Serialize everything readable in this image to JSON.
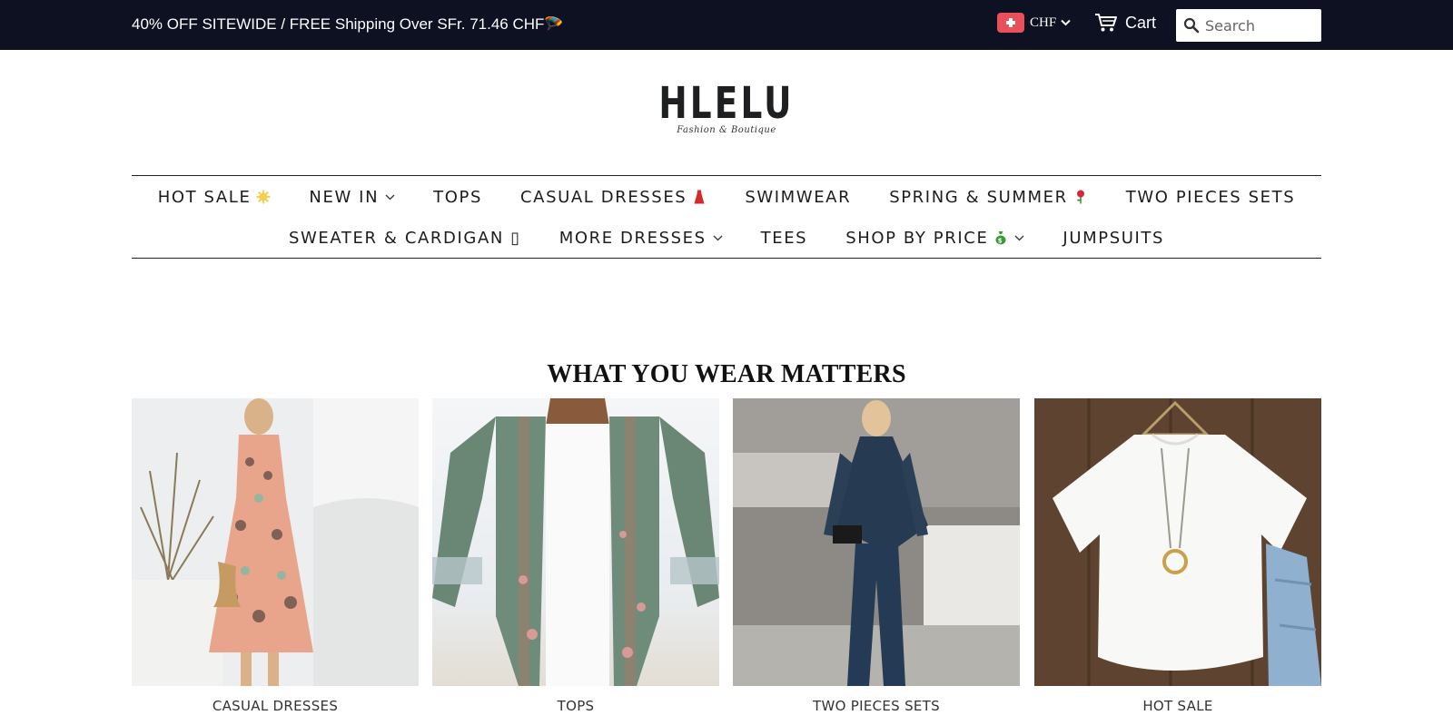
{
  "announcement": "40% OFF SITEWIDE / FREE Shipping Over SFr. 71.46 CHF🪂",
  "currency": {
    "code": "CHF",
    "flag_color": "#e8505b"
  },
  "cart": {
    "label": "Cart"
  },
  "search": {
    "placeholder": "Search"
  },
  "logo": {
    "name": "HLELU",
    "tagline": "Fashion & Boutique"
  },
  "nav": {
    "row1": [
      {
        "label": "HOT SALE",
        "emoji": "sun",
        "dropdown": false
      },
      {
        "label": "NEW IN",
        "dropdown": true
      },
      {
        "label": "TOPS",
        "dropdown": false
      },
      {
        "label": "CASUAL DRESSES",
        "emoji": "dress",
        "dropdown": false
      },
      {
        "label": "SWIMWEAR",
        "dropdown": false
      },
      {
        "label": "SPRING & SUMMER",
        "emoji": "rose",
        "dropdown": false
      },
      {
        "label": "TWO PIECES SETS",
        "dropdown": false
      }
    ],
    "row2": [
      {
        "label": "SWEATER & CARDIGAN ▯",
        "dropdown": false
      },
      {
        "label": "MORE DRESSES",
        "dropdown": true
      },
      {
        "label": "TEES",
        "dropdown": false
      },
      {
        "label": "SHOP BY PRICE",
        "emoji": "money-bag",
        "dropdown": true
      },
      {
        "label": "JUMPSUITS",
        "dropdown": false
      }
    ]
  },
  "section": {
    "title": "WHAT YOU WEAR MATTERS",
    "collections": [
      {
        "label": "CASUAL DRESSES"
      },
      {
        "label": "TOPS"
      },
      {
        "label": "TWO PIECES SETS"
      },
      {
        "label": "HOT SALE"
      }
    ]
  },
  "colors": {
    "topbar_bg": "#0d1122",
    "text": "#1c1d1d"
  }
}
